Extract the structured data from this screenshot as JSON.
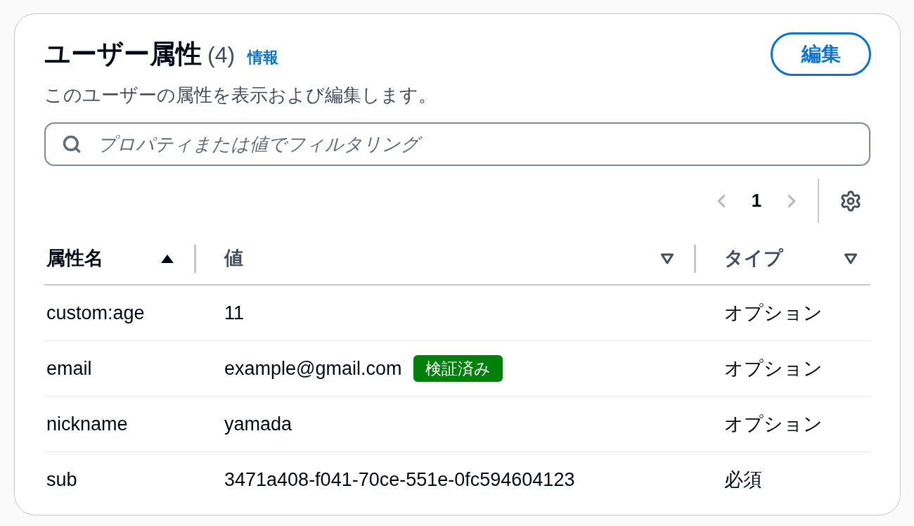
{
  "header": {
    "title": "ユーザー属性",
    "count": "(4)",
    "info_link": "情報",
    "description": "このユーザーの属性を表示および編集します。",
    "edit_button": "編集"
  },
  "filter": {
    "placeholder": "プロパティまたは値でフィルタリング"
  },
  "pagination": {
    "page": "1",
    "previous_disabled": true,
    "next_disabled": true
  },
  "table": {
    "columns": [
      {
        "label": "属性名",
        "sorted": true
      },
      {
        "label": "値",
        "sorted": false
      },
      {
        "label": "タイプ",
        "sorted": false
      }
    ],
    "rows": [
      {
        "name": "custom:age",
        "value": "11",
        "type": "オプション"
      },
      {
        "name": "email",
        "value": "example@gmail.com",
        "badge": "検証済み",
        "type": "オプション"
      },
      {
        "name": "nickname",
        "value": "yamada",
        "type": "オプション"
      },
      {
        "name": "sub",
        "value": "3471a408-f041-70ce-551e-0fc594604123",
        "type": "必須"
      }
    ]
  }
}
